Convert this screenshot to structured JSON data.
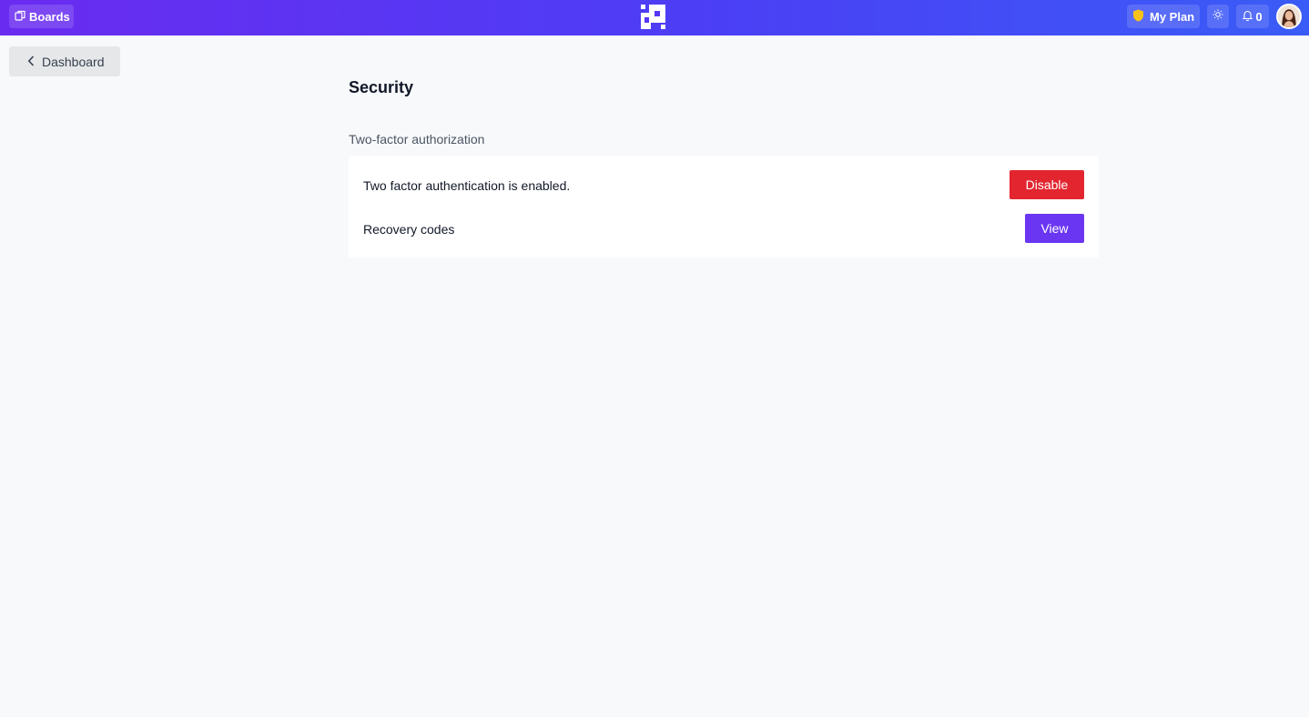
{
  "topbar": {
    "boards_label": "Boards",
    "plan_label": "My Plan",
    "notification_count": "0",
    "gradient_start": "#6a2bf0",
    "gradient_end": "#3a5cf6",
    "icons": [
      "boards-icon",
      "app-logo",
      "shield-icon",
      "sun-icon",
      "bell-icon",
      "user-avatar"
    ]
  },
  "nav": {
    "back_label": "Dashboard"
  },
  "page": {
    "title": "Security",
    "section_label": "Two-factor authorization",
    "rows": [
      {
        "text": "Two factor authentication is enabled.",
        "action": "Disable",
        "action_color": "#e2252f"
      },
      {
        "text": "Recovery codes",
        "action": "View",
        "action_color": "#6a36f2"
      }
    ]
  }
}
